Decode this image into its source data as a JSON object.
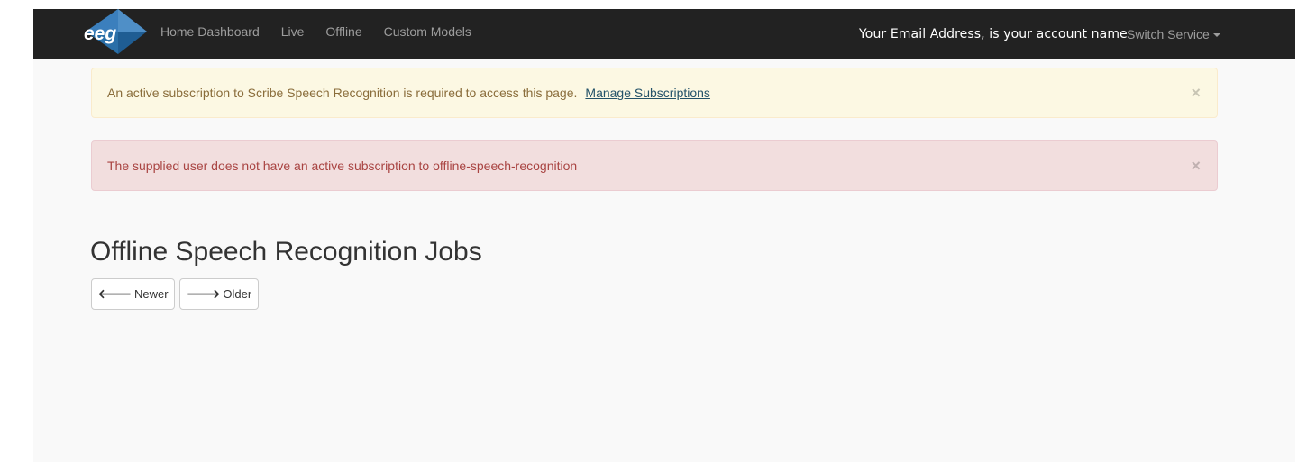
{
  "navbar": {
    "brand": "eeg",
    "links": [
      "Home Dashboard",
      "Live",
      "Offline",
      "Custom Models"
    ],
    "account_text": "Your Email Address, is your account name",
    "switch_service_label": "Switch Service"
  },
  "alerts": {
    "warning": {
      "text": "An active subscription to Scribe Speech Recognition is required to access this page.",
      "link_label": "Manage Subscriptions",
      "close_glyph": "×"
    },
    "danger": {
      "text": "The supplied user does not have an active subscription to offline-speech-recognition",
      "close_glyph": "×"
    }
  },
  "page": {
    "title": "Offline Speech Recognition Jobs",
    "newer_label": "Newer",
    "older_label": "Older"
  },
  "icons": {
    "left_arrow": "🡐",
    "right_arrow": "🡒"
  },
  "colors": {
    "navbar_bg": "#222222",
    "logo_blue": "#2a6fa8",
    "warning_bg": "#fcf8e3",
    "danger_bg": "#f2dede"
  }
}
